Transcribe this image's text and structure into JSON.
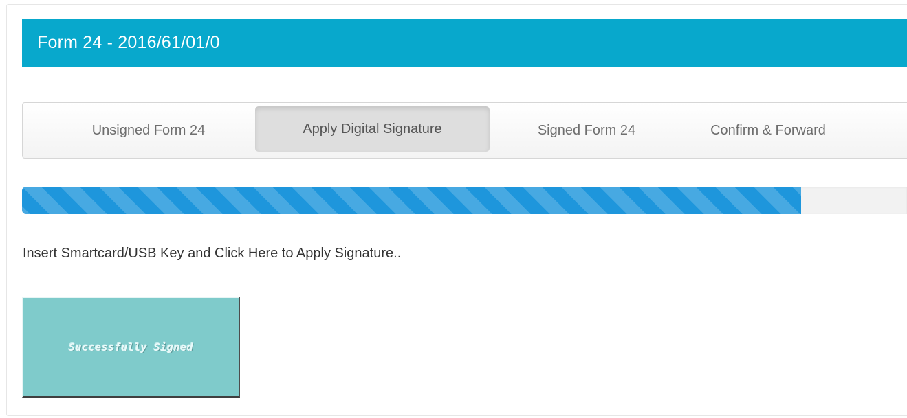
{
  "form": {
    "title": "Form 24 - 2016/61/01/0",
    "header_color": "#08a8cc"
  },
  "tabs": [
    {
      "label": "Unsigned Form 24",
      "active": false
    },
    {
      "label": "Apply Digital Signature",
      "active": true
    },
    {
      "label": "Signed Form 24",
      "active": false
    },
    {
      "label": "Confirm & Forward",
      "active": false
    }
  ],
  "progress": {
    "value_percent": 88,
    "fill_color": "#1e96dc",
    "style": "striped"
  },
  "instruction": {
    "text": "Insert Smartcard/USB Key and Click Here to Apply Signature.."
  },
  "signature_status": {
    "label": "Successfully Signed",
    "background_color": "#7fcbcb"
  }
}
